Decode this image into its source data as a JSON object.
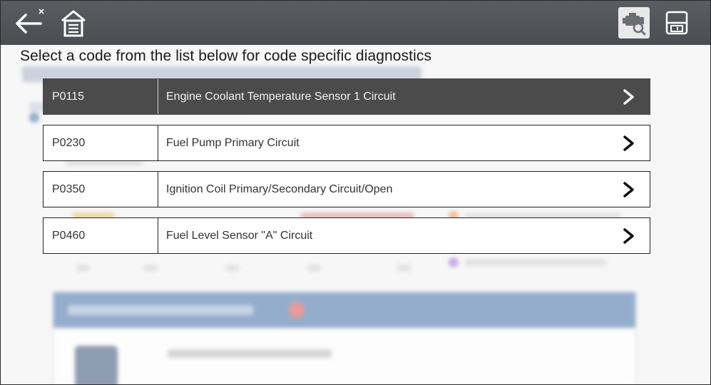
{
  "toolbar": {
    "left_icons": [
      "back-arrow-icon",
      "home-icon"
    ],
    "right_icons": [
      "vehicle-scan-icon",
      "save-icon"
    ]
  },
  "instruction": "Select a code from the list below for code specific diagnostics",
  "codes": [
    {
      "code": "P0115",
      "description": "Engine Coolant Temperature Sensor 1 Circuit",
      "selected": true
    },
    {
      "code": "P0230",
      "description": "Fuel Pump Primary Circuit",
      "selected": false
    },
    {
      "code": "P0350",
      "description": "Ignition Coil Primary/Secondary Circuit/Open",
      "selected": false
    },
    {
      "code": "P0460",
      "description": "Fuel Level Sensor \"A\" Circuit",
      "selected": false
    }
  ],
  "colors": {
    "toolbar": "#4f5257",
    "selected_row": "#4b4b4b",
    "row_background": "#ffffff",
    "panel_header": "#2b5d9c"
  }
}
